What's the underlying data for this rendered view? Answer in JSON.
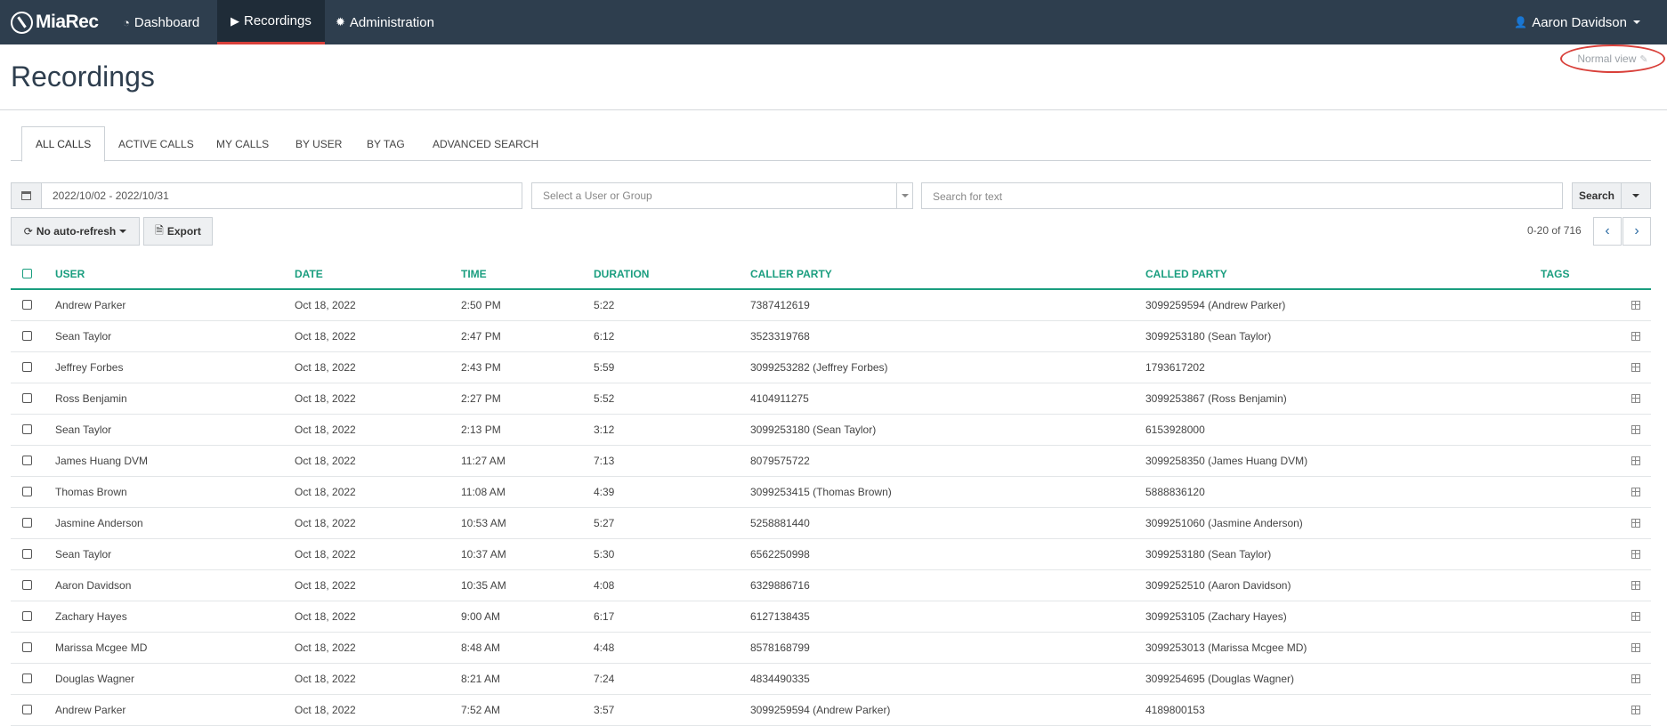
{
  "nav": {
    "brand": "MiaRec",
    "items": [
      {
        "label": "Dashboard",
        "icon": "tachometer-icon"
      },
      {
        "label": "Recordings",
        "icon": "play-square-icon"
      },
      {
        "label": "Administration",
        "icon": "gear-icon"
      }
    ],
    "active": "Recordings",
    "user": "Aaron Davidson"
  },
  "page": {
    "title": "Recordings",
    "view_toggle": "Normal view"
  },
  "tabs": [
    "ALL CALLS",
    "ACTIVE CALLS",
    "MY CALLS",
    "BY USER",
    "BY TAG",
    "ADVANCED SEARCH"
  ],
  "active_tab": "ALL CALLS",
  "filters": {
    "date_range": "2022/10/02 - 2022/10/31",
    "user_placeholder": "Select a User or Group",
    "search_placeholder": "Search for text",
    "search_label": "Search"
  },
  "toolbar": {
    "refresh_label": "No auto-refresh",
    "export_label": "Export",
    "pager_text": "0-20 of 716"
  },
  "table": {
    "columns": [
      "USER",
      "DATE",
      "TIME",
      "DURATION",
      "CALLER PARTY",
      "CALLED PARTY",
      "TAGS"
    ],
    "rows": [
      {
        "user": "Andrew Parker",
        "date": "Oct 18, 2022",
        "time": "2:50 PM",
        "duration": "5:22",
        "caller": "7387412619",
        "called": "3099259594 (Andrew Parker)"
      },
      {
        "user": "Sean Taylor",
        "date": "Oct 18, 2022",
        "time": "2:47 PM",
        "duration": "6:12",
        "caller": "3523319768",
        "called": "3099253180 (Sean Taylor)"
      },
      {
        "user": "Jeffrey Forbes",
        "date": "Oct 18, 2022",
        "time": "2:43 PM",
        "duration": "5:59",
        "caller": "3099253282 (Jeffrey Forbes)",
        "called": "1793617202"
      },
      {
        "user": "Ross Benjamin",
        "date": "Oct 18, 2022",
        "time": "2:27 PM",
        "duration": "5:52",
        "caller": "4104911275",
        "called": "3099253867 (Ross Benjamin)"
      },
      {
        "user": "Sean Taylor",
        "date": "Oct 18, 2022",
        "time": "2:13 PM",
        "duration": "3:12",
        "caller": "3099253180 (Sean Taylor)",
        "called": "6153928000"
      },
      {
        "user": "James Huang DVM",
        "date": "Oct 18, 2022",
        "time": "11:27 AM",
        "duration": "7:13",
        "caller": "8079575722",
        "called": "3099258350 (James Huang DVM)"
      },
      {
        "user": "Thomas Brown",
        "date": "Oct 18, 2022",
        "time": "11:08 AM",
        "duration": "4:39",
        "caller": "3099253415 (Thomas Brown)",
        "called": "5888836120"
      },
      {
        "user": "Jasmine Anderson",
        "date": "Oct 18, 2022",
        "time": "10:53 AM",
        "duration": "5:27",
        "caller": "5258881440",
        "called": "3099251060 (Jasmine Anderson)"
      },
      {
        "user": "Sean Taylor",
        "date": "Oct 18, 2022",
        "time": "10:37 AM",
        "duration": "5:30",
        "caller": "6562250998",
        "called": "3099253180 (Sean Taylor)"
      },
      {
        "user": "Aaron Davidson",
        "date": "Oct 18, 2022",
        "time": "10:35 AM",
        "duration": "4:08",
        "caller": "6329886716",
        "called": "3099252510 (Aaron Davidson)"
      },
      {
        "user": "Zachary Hayes",
        "date": "Oct 18, 2022",
        "time": "9:00 AM",
        "duration": "6:17",
        "caller": "6127138435",
        "called": "3099253105 (Zachary Hayes)"
      },
      {
        "user": "Marissa Mcgee MD",
        "date": "Oct 18, 2022",
        "time": "8:48 AM",
        "duration": "4:48",
        "caller": "8578168799",
        "called": "3099253013 (Marissa Mcgee MD)"
      },
      {
        "user": "Douglas Wagner",
        "date": "Oct 18, 2022",
        "time": "8:21 AM",
        "duration": "7:24",
        "caller": "4834490335",
        "called": "3099254695 (Douglas Wagner)"
      },
      {
        "user": "Andrew Parker",
        "date": "Oct 18, 2022",
        "time": "7:52 AM",
        "duration": "3:57",
        "caller": "3099259594 (Andrew Parker)",
        "called": "4189800153"
      }
    ]
  }
}
